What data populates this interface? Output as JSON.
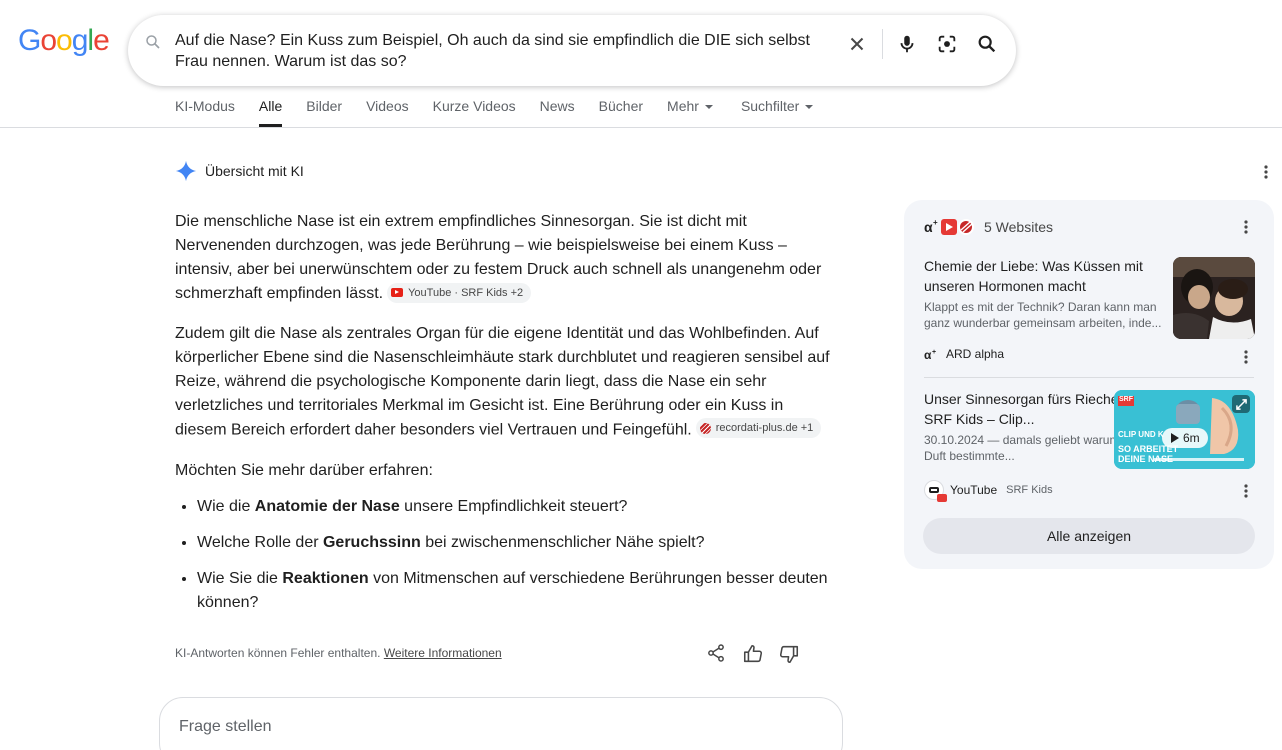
{
  "header": {
    "logo_letters": [
      "G",
      "o",
      "o",
      "g",
      "l",
      "e"
    ],
    "search_query": "Auf die Nase? Ein Kuss zum Beispiel, Oh auch da sind sie empfindlich die DIE sich selbst Frau nennen. Warum ist das so?"
  },
  "tabs": [
    {
      "label": "KI-Modus"
    },
    {
      "label": "Alle",
      "active": true
    },
    {
      "label": "Bilder"
    },
    {
      "label": "Videos"
    },
    {
      "label": "Kurze Videos"
    },
    {
      "label": "News"
    },
    {
      "label": "Bücher"
    },
    {
      "label": "Mehr"
    },
    {
      "label": "Suchfilter"
    }
  ],
  "ai_overview": {
    "heading": "Übersicht mit KI",
    "paragraph1": "Die menschliche Nase ist ein extrem empfindliches Sinnesorgan. Sie ist dicht mit Nervenenden durchzogen, was jede Berührung – wie beispielsweise bei einem Kuss – intensiv, aber bei unerwünschtem oder zu festem Druck auch schnell als unangenehm oder schmerzhaft empfinden lässt.",
    "chip1": "YouTube · SRF Kids +2",
    "paragraph2": "Zudem gilt die Nase als zentrales Organ für die eigene Identität und das Wohlbefinden. Auf körperlicher Ebene sind die Nasenschleimhäute stark durchblutet und reagieren sensibel auf Reize, während die psychologische Komponente darin liegt, dass die Nase ein sehr verletzliches und territoriales Merkmal im Gesicht ist. Eine Berührung oder ein Kuss in diesem Bereich erfordert daher besonders viel Vertrauen und Feingefühl.",
    "chip2": "recordati-plus.de +1",
    "more_prompt": "Möchten Sie mehr darüber erfahren:",
    "bullets": [
      {
        "pre": "Wie die ",
        "bold": "Anatomie der Nase",
        "post": " unsere Empfindlichkeit steuert?"
      },
      {
        "pre": "Welche Rolle der ",
        "bold": "Geruchssinn",
        "post": " bei zwischenmenschlicher Nähe spielt?"
      },
      {
        "pre": "Wie Sie die ",
        "bold": "Reaktionen",
        "post": " von Mitmenschen auf verschiedene Berührungen besser deuten können?"
      }
    ],
    "disclaimer": "KI-Antworten können Fehler enthalten.",
    "disclaimer_link": "Weitere Informationen",
    "ask_placeholder": "Frage stellen"
  },
  "panel": {
    "sites_label": "5 Websites",
    "cards": [
      {
        "title": "Chemie der Liebe: Was Küssen mit unseren Hormonen macht",
        "desc": "Klappt es mit der Technik? Daran kann man ganz wunderbar gemeinsam arbeiten, inde...",
        "source": "ARD alpha"
      },
      {
        "title": "Unser Sinnesorgan fürs Riechen | SRF Kids – Clip...",
        "desc": "30.10.2024 — damals geliebt warum so ein Duft bestimmte...",
        "source": "YouTube",
        "source_sub": "SRF Kids",
        "duration": "6m",
        "thumb_text_top": "CLIP UND K",
        "thumb_text_bottom": "SO ARBEITET DEINE NASE",
        "thumb_badge": "SRF"
      }
    ],
    "show_all": "Alle anzeigen"
  },
  "colors": {
    "google_blue": "#4285F4",
    "google_red": "#EA4335",
    "google_yellow": "#FBBC05",
    "google_green": "#34A853",
    "panel_bg": "#f3f5f9"
  }
}
